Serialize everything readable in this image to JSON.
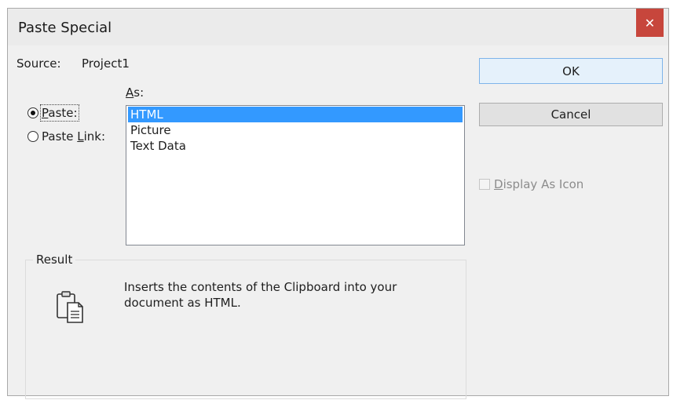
{
  "window": {
    "title": "Paste Special",
    "close_glyph": "✕"
  },
  "source": {
    "label": "Source:",
    "value": "Project1"
  },
  "as_label": "As:",
  "radios": {
    "paste": {
      "label": "Paste:",
      "checked": true
    },
    "paste_link": {
      "label": "Paste Link:",
      "checked": false
    }
  },
  "formats": [
    {
      "label": "HTML",
      "selected": true
    },
    {
      "label": "Picture",
      "selected": false
    },
    {
      "label": "Text Data",
      "selected": false
    }
  ],
  "result": {
    "legend": "Result",
    "line1": "Inserts the contents of the Clipboard into your",
    "line2": "document as HTML.",
    "icon": "clipboard-paste-icon"
  },
  "buttons": {
    "ok": "OK",
    "cancel": "Cancel"
  },
  "display_as_icon": {
    "label": "Display As Icon",
    "checked": false,
    "enabled": false
  },
  "colors": {
    "selection": "#3399ff",
    "close_button": "#c7463c",
    "default_button_border": "#7eb4ea"
  }
}
